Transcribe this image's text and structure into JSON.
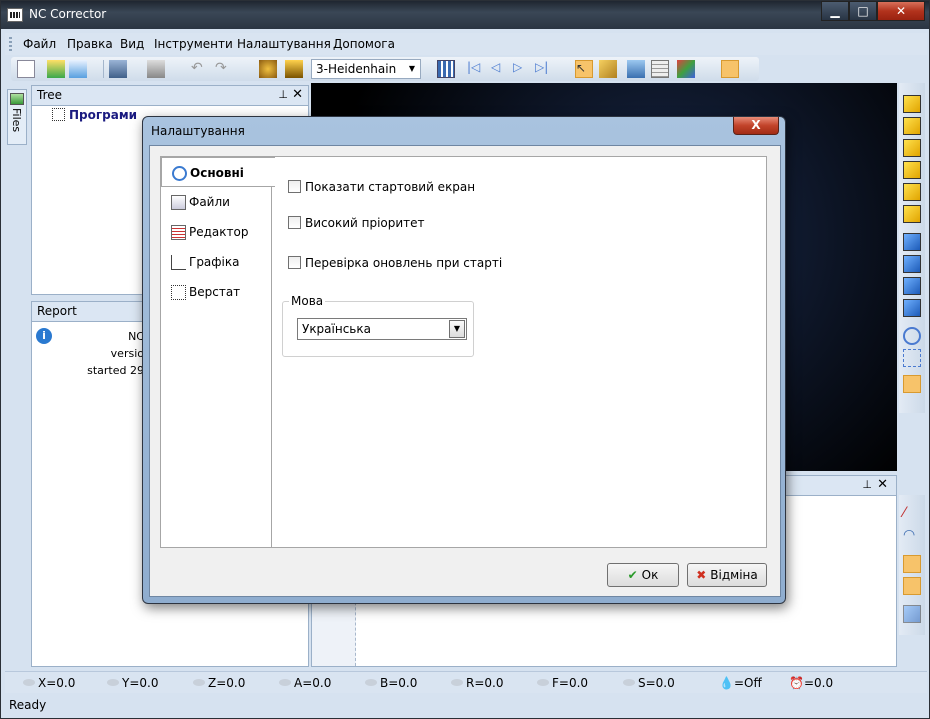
{
  "window": {
    "title": "NC Corrector",
    "min_glyph": "▁",
    "max_glyph": "□",
    "close_glyph": "✕"
  },
  "menu": [
    "Файл",
    "Правка",
    "Вид",
    "Інструменти",
    "Налаштування",
    "Допомога"
  ],
  "toolbar": {
    "postprocessor": "3-Heidenhain"
  },
  "tree_panel": {
    "title": "Tree",
    "root_item": "Програми",
    "pin_glyph": "⊥",
    "close_glyph": "✕"
  },
  "files_tab": {
    "label": "Files"
  },
  "report_panel": {
    "title": "Report",
    "lines": [
      "NC",
      "versio",
      "started 29"
    ]
  },
  "status": {
    "coords": [
      "X=0.0",
      "Y=0.0",
      "Z=0.0",
      "A=0.0",
      "B=0.0",
      "R=0.0",
      "F=0.0",
      "S=0.0"
    ],
    "coolant": "=Off",
    "time": "=0.0",
    "ready": "Ready"
  },
  "dialog": {
    "title": "Налаштування",
    "close_glyph": "X",
    "nav": [
      "Основні",
      "Файли",
      "Редактор",
      "Графіка",
      "Верстат"
    ],
    "nav_active": 0,
    "options": [
      {
        "label": "Показати стартовий екран",
        "checked": false
      },
      {
        "label": "Високий пріоритет",
        "checked": false
      },
      {
        "label": "Перевірка оновлень при старті",
        "checked": false
      }
    ],
    "language_group": "Мова",
    "language_value": "Українська",
    "ok_label": "Ок",
    "cancel_label": "Відміна"
  },
  "colors": {
    "accent": "#3a7bd5",
    "titlebar": "#2b3542",
    "close": "#c2432a"
  }
}
